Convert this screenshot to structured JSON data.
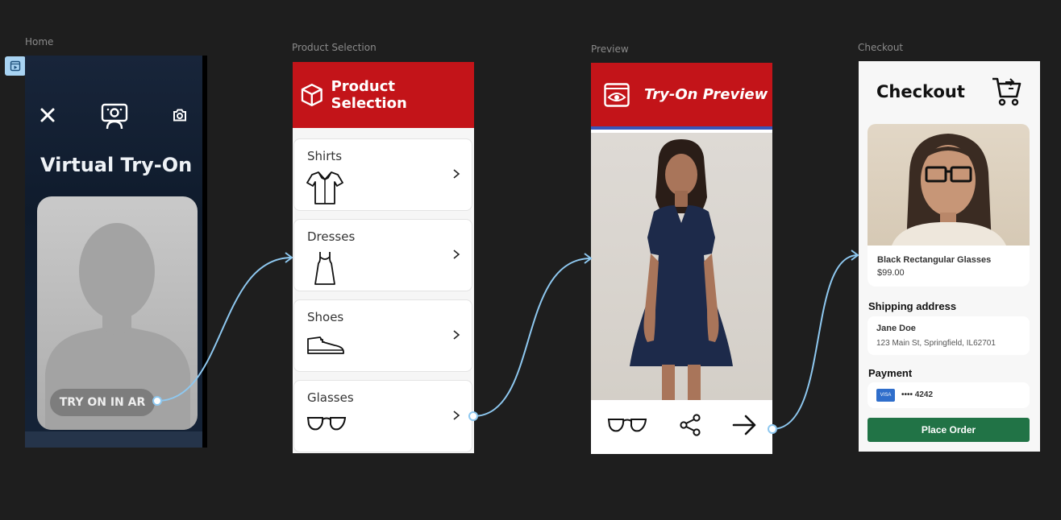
{
  "frames": {
    "home": "Home",
    "product_selection": "Product Selection",
    "preview": "Preview",
    "checkout": "Checkout"
  },
  "home": {
    "title": "Virtual Try-On",
    "ar_button": "TRY ON IN AR"
  },
  "product_selection": {
    "header": "Product Selection",
    "categories": [
      {
        "label": "Shirts",
        "icon": "shirt-icon"
      },
      {
        "label": "Dresses",
        "icon": "dress-icon"
      },
      {
        "label": "Shoes",
        "icon": "shoe-icon"
      },
      {
        "label": "Glasses",
        "icon": "glasses-icon"
      }
    ]
  },
  "preview": {
    "header": "Try-On Preview"
  },
  "checkout": {
    "title": "Checkout",
    "product_name": "Black Rectangular Glasses",
    "product_price": "$99.00",
    "shipping_heading": "Shipping address",
    "shipping_name": "Jane Doe",
    "shipping_address": "123 Main St, Springfield, IL62701",
    "payment_heading": "Payment",
    "card_brand": "VISA",
    "card_number": "•••• 4242",
    "place_order": "Place Order"
  },
  "colors": {
    "header_red": "#c31419",
    "order_green": "#217346",
    "connector_blue": "#8ec8f0"
  }
}
